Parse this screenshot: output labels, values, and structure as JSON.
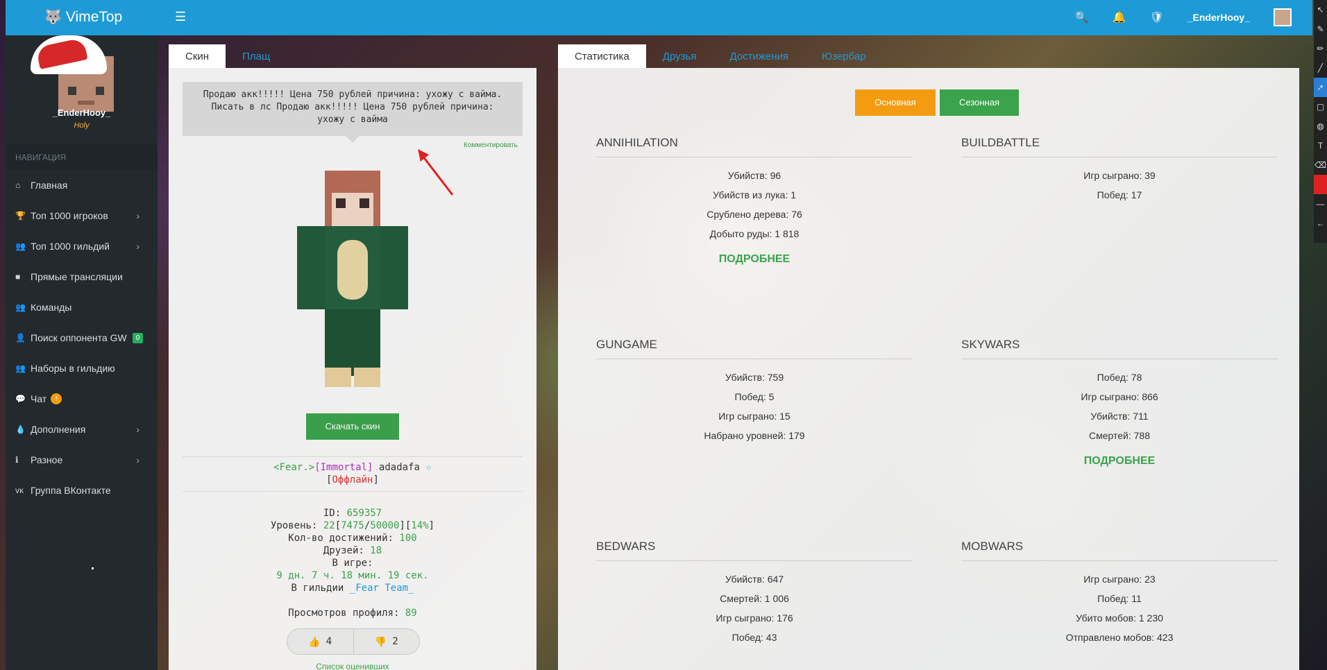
{
  "header": {
    "brand": "VimeTop",
    "username": "_EnderHooy_"
  },
  "sidebar": {
    "profile_name": "_EnderHooy_",
    "profile_rank": "Holy",
    "nav_heading": "НАВИГАЦИЯ",
    "items": [
      {
        "label": "Главная",
        "icon": "home-icon"
      },
      {
        "label": "Топ 1000 игроков",
        "icon": "trophy-icon"
      },
      {
        "label": "Топ 1000 гильдий",
        "icon": "users-icon"
      },
      {
        "label": "Прямые трансляции",
        "icon": "video-icon"
      },
      {
        "label": "Команды",
        "icon": "team-icon"
      },
      {
        "label": "Поиск оппонента GW",
        "icon": "user-icon",
        "badge": "0"
      },
      {
        "label": "Наборы в гильдию",
        "icon": "group-icon"
      },
      {
        "label": "Чат",
        "icon": "chat-icon",
        "badge": "!"
      },
      {
        "label": "Дополнения",
        "icon": "drop-icon"
      },
      {
        "label": "Разное",
        "icon": "info-icon"
      },
      {
        "label": "Группа ВКонтакте",
        "icon": "vk-icon"
      }
    ]
  },
  "left": {
    "tabs": [
      "Скин",
      "Плащ"
    ],
    "status_text": "Продаю акк!!!!! Цена 750 рублей причина: ухожу с вайма. Писать в лс Продаю акк!!!!! Цена 750 рублей причина: ухожу с вайма",
    "comment_link": "Комментировать",
    "download_button": "Скачать скин",
    "prefix1": "<Fear.>",
    "prefix2": "[Immortal]",
    "player": "adadafa",
    "star": "☆",
    "status_bracket_open": "[",
    "status_offline": "Оффлайн",
    "status_bracket_close": "]",
    "id_label": "ID:",
    "id_value": "659357",
    "level_label": "Уровень:",
    "level_value": "22",
    "level_exp": "7475",
    "level_exp_max": "50000",
    "level_pct": "14%",
    "achievements_label": "Кол-во достижений:",
    "achievements_value": "100",
    "friends_label": "Друзей:",
    "friends_value": "18",
    "ingame_label": "В игре:",
    "ingame_value": "9 дн. 7 ч. 18 мин. 19 сек.",
    "guild_label": "В гильдии",
    "guild_value": "_Fear Team_",
    "views_label": "Просмотров профиля:",
    "views_value": "89",
    "likes": "4",
    "dislikes": "2",
    "raters_link": "Список оценивших"
  },
  "right": {
    "tabs": [
      "Статистика",
      "Друзья",
      "Достижения",
      "Юзербар"
    ],
    "btn_main": "Основная",
    "btn_season": "Сезонная",
    "more": "ПОДРОБНЕЕ",
    "games": [
      {
        "title": "ANNIHILATION",
        "stats": [
          "Убийств: 96",
          "Убийств из лука: 1",
          "Срублено дерева: 76",
          "Добыто руды: 1 818"
        ],
        "more": true
      },
      {
        "title": "BUILDBATTLE",
        "stats": [
          "Игр сыграно: 39",
          "Побед: 17"
        ],
        "more": false
      },
      {
        "title": "GUNGAME",
        "stats": [
          "Убийств: 759",
          "Побед: 5",
          "Игр сыграно: 15",
          "Набрано уровней: 179"
        ],
        "more": false
      },
      {
        "title": "SKYWARS",
        "stats": [
          "Побед: 78",
          "Игр сыграно: 866",
          "Убийств: 711",
          "Смертей: 788"
        ],
        "more": true
      },
      {
        "title": "BEDWARS",
        "stats": [
          "Убийств: 647",
          "Смертей: 1 006",
          "Игр сыграно: 176",
          "Побед: 43"
        ],
        "more": false
      },
      {
        "title": "MOBWARS",
        "stats": [
          "Игр сыграно: 23",
          "Побед: 11",
          "Убито мобов: 1 230",
          "Отправлено мобов: 423"
        ],
        "more": false
      }
    ]
  }
}
